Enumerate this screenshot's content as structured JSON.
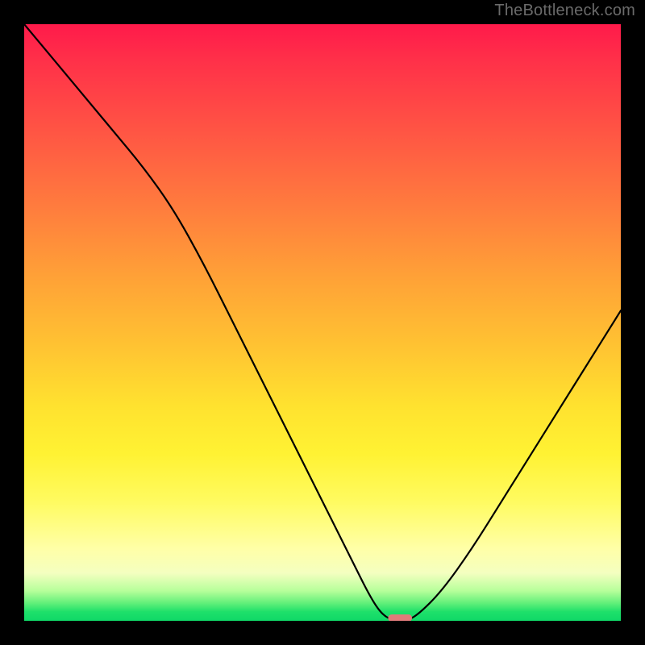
{
  "watermark": "TheBottleneck.com",
  "colors": {
    "frame": "#000000",
    "curve": "#000000",
    "marker": "#e07a7a",
    "gradient_top": "#ff1a4a",
    "gradient_bottom": "#0fd867"
  },
  "chart_data": {
    "type": "line",
    "title": "",
    "xlabel": "",
    "ylabel": "",
    "xlim": [
      0,
      100
    ],
    "ylim": [
      0,
      100
    ],
    "x": [
      0,
      5,
      10,
      15,
      20,
      25,
      30,
      35,
      40,
      45,
      50,
      55,
      58,
      60,
      62,
      64,
      66,
      70,
      75,
      80,
      85,
      90,
      95,
      100
    ],
    "values": [
      100,
      94,
      88,
      82,
      76,
      69,
      60,
      50,
      40,
      30,
      20,
      10,
      4,
      1,
      0,
      0,
      1,
      5,
      12,
      20,
      28,
      36,
      44,
      52
    ],
    "marker": {
      "x": 63,
      "y": 0,
      "width": 4,
      "height": 1.2
    },
    "notes": "V-shaped bottleneck curve; minimum near x≈63%. Background encodes value: red (high bottleneck) → green (low)."
  }
}
